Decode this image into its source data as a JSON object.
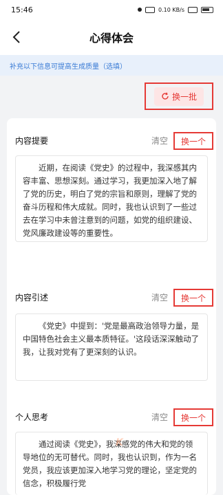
{
  "status_bar": {
    "time": "15:46",
    "network_speed": "0.10 KB/s"
  },
  "nav": {
    "title": "心得体会"
  },
  "hint": {
    "text": "补充以下信息可提高生成质量（选填）"
  },
  "batch": {
    "label": "换一批"
  },
  "sections": [
    {
      "title": "内容提要",
      "clear_label": "清空",
      "swap_label": "换一个",
      "content": "近期，在阅读《党史》的过程中，我深感其内容丰富、思想深刻。通过学习，我更加深入地了解了党的历史，明白了党的宗旨和原则，理解了党的奋斗历程和伟大成就。同时，我也认识到了一些过去在学习中未曾注意到的问题，如党的组织建设、党风廉政建设等的重要性。"
    },
    {
      "title": "内容引述",
      "clear_label": "清空",
      "swap_label": "换一个",
      "content": "《党史》中提到：'党是最高政治领导力量，是中国特色社会主义最本质特征。'这段话深深触动了我，让我对党有了更深刻的认识。"
    },
    {
      "title": "个人思考",
      "clear_label": "清空",
      "swap_label": "换一个",
      "content": "通过阅读《党史》，我深感党的伟大和党的领导地位的无可替代。同时，我也认识到，作为一名党员，我应该更加深入地学习党的理论，坚定党的信念，积极履行党"
    }
  ],
  "icons": {
    "back": "chevron-left-icon",
    "refresh": "refresh-icon"
  },
  "colors": {
    "accent_red": "#e53935",
    "hint_blue": "#3a7bd5",
    "hint_bg": "#e8f0fb"
  }
}
